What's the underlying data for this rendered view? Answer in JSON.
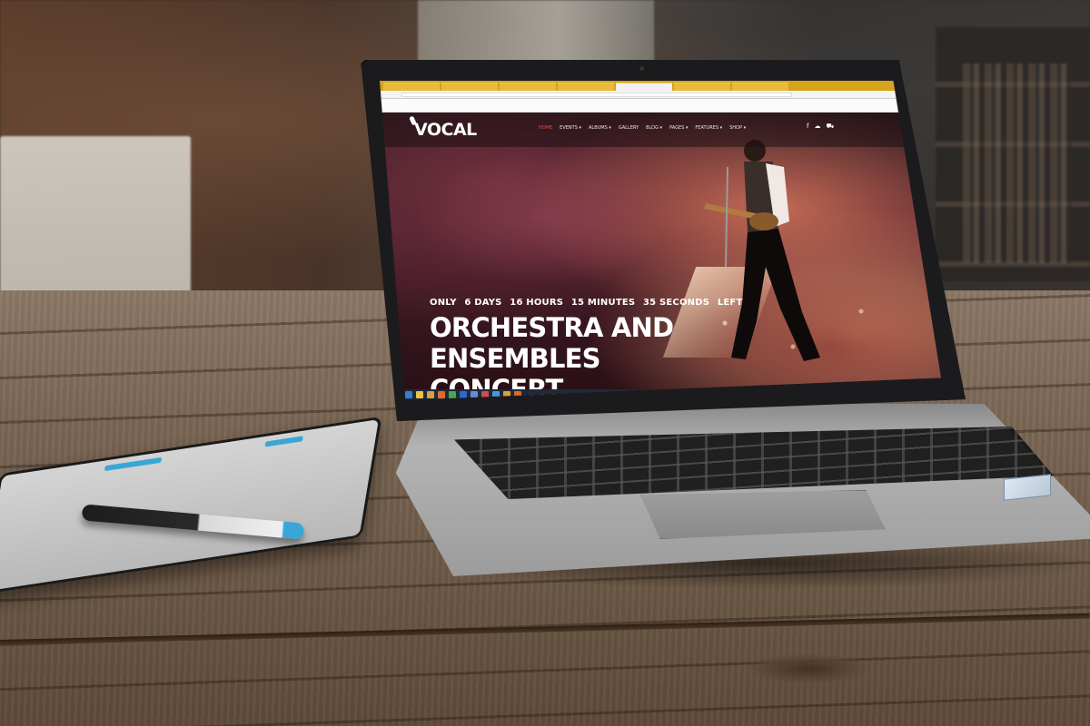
{
  "website": {
    "logo": "VOCAL",
    "nav": [
      {
        "label": "HOME",
        "active": true
      },
      {
        "label": "EVENTS ▾",
        "active": false
      },
      {
        "label": "ALBUMS ▾",
        "active": false
      },
      {
        "label": "GALLERY",
        "active": false
      },
      {
        "label": "BLOG ▾",
        "active": false
      },
      {
        "label": "PAGES ▾",
        "active": false
      },
      {
        "label": "FEATURES ▾",
        "active": false
      },
      {
        "label": "SHOP ▾",
        "active": false
      }
    ],
    "social_icons": [
      "facebook-icon",
      "soundcloud-icon",
      "cart-icon"
    ],
    "countdown": {
      "prefix": "ONLY",
      "days": "6 DAYS",
      "hours": "16 HOURS",
      "minutes": "15 MINUTES",
      "seconds": "35 SECONDS",
      "suffix": "LEFT"
    },
    "event_title_line1": "ORCHESTRA AND ENSEMBLES",
    "event_title_line2": "CONCERT"
  },
  "colors": {
    "browser_tabbar": "#d6a31a",
    "nav_active": "#e34a3a",
    "taskbar": "#1e2a38",
    "tablet_accent": "#3aa6d8"
  },
  "taskbar_icons": [
    "start-icon",
    "explorer-icon",
    "folder-icon",
    "browser-icon",
    "chrome-icon",
    "media-icon",
    "app-icon",
    "app-icon",
    "app-icon",
    "app-icon",
    "app-icon"
  ]
}
